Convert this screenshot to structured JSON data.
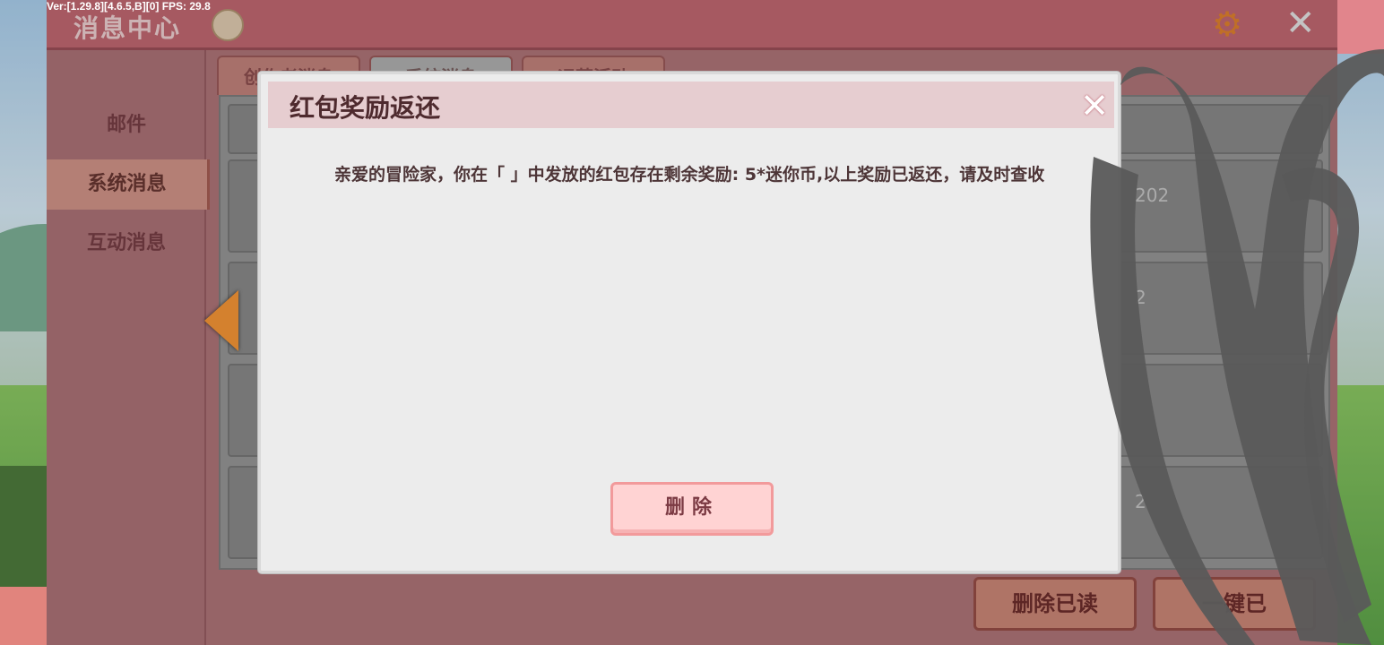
{
  "debug": {
    "fps_text": "Ver:[1.29.8][4.6.5,B][0] FPS: 29.8"
  },
  "window": {
    "title": "消息中心"
  },
  "sidebar": {
    "items": [
      {
        "label": "邮件"
      },
      {
        "label": "系统消息"
      },
      {
        "label": "互动消息"
      }
    ]
  },
  "tabs": [
    {
      "label": "创作者消息"
    },
    {
      "label": "系统消息"
    },
    {
      "label": "运营活动"
    }
  ],
  "list": {
    "rows": [
      {
        "date": ""
      },
      {
        "date": "202"
      },
      {
        "date": "2"
      },
      {
        "date": ""
      },
      {
        "date": "2"
      }
    ]
  },
  "actions": {
    "delete_read": "删除已读",
    "one_key": "一键已"
  },
  "dialog": {
    "title": "红包奖励返还",
    "body": "亲爱的冒险家，你在「 」中发放的红包存在剩余奖励: 5*迷你币,以上奖励已返还，请及时查收",
    "delete_label": "删除"
  },
  "colors": {
    "accent": "#b75a63",
    "dialog_bg": "#ececec",
    "button_pink": "#ffd3d3"
  },
  "icons": [
    "info-icon",
    "gear-icon",
    "close-icon",
    "left-arrow-icon",
    "dialog-close-icon"
  ]
}
